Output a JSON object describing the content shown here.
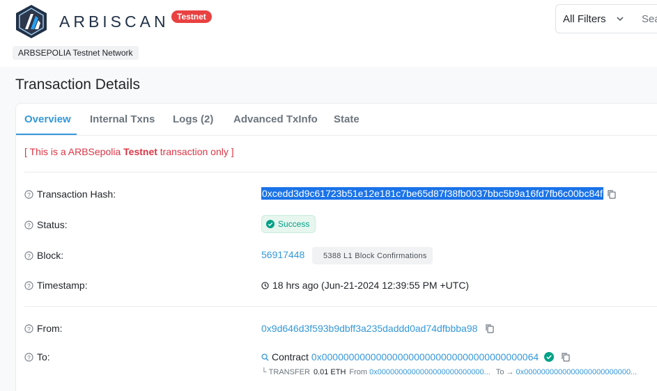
{
  "header": {
    "brand": "ARBISCAN",
    "brand_badge": "Testnet",
    "network": "ARBSEPOLIA Testnet Network",
    "filter_label": "All Filters",
    "search_placeholder": "Sea"
  },
  "page": {
    "title": "Transaction Details"
  },
  "tabs": [
    {
      "label": "Overview"
    },
    {
      "label": "Internal Txns"
    },
    {
      "label": "Logs (2)"
    },
    {
      "label": "Advanced TxInfo"
    },
    {
      "label": "State"
    }
  ],
  "notice": {
    "prefix": "[ This is a ARBSepolia ",
    "bold": "Testnet",
    "suffix": " transaction only ]"
  },
  "details": {
    "hash_label": "Transaction Hash:",
    "hash_value": "0xcedd3d9c61723b51e12e181c7be65d87f38fb0037bbc5b9a16fd7fb6c00bc84f",
    "status_label": "Status:",
    "status_value": "Success",
    "block_label": "Block:",
    "block_value": "56917448",
    "block_confirmations": "5388 L1 Block Confirmations",
    "timestamp_label": "Timestamp:",
    "timestamp_value": "18 hrs ago (Jun-21-2024 12:39:55 PM +UTC)",
    "from_label": "From:",
    "from_value": "0x9d646d3f593b9dbff3a235daddd0ad74dfbbba98",
    "to_label": "To:",
    "to_contract_word": "Contract",
    "to_value": "0x0000000000000000000000000000000000000064",
    "transfer_prefix": "└ TRANSFER",
    "transfer_amount": "0.01 ETH",
    "transfer_from_word": "From",
    "transfer_from_addr": "0x0000000000000000000000000...",
    "transfer_to_word": "To →",
    "transfer_to_addr": "0x0000000000000000000000000..."
  },
  "colors": {
    "accent": "#3498db",
    "testnet_red": "#e94141",
    "success": "#00a186"
  }
}
